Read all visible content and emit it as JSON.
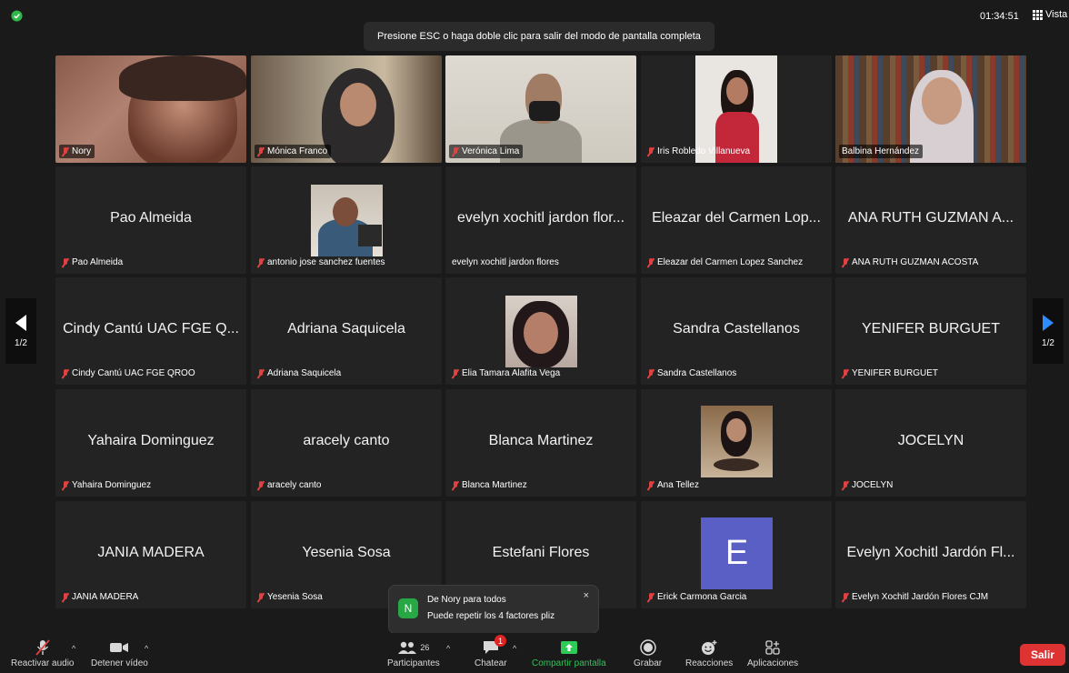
{
  "topbar": {
    "banner_text": "Presione ESC o haga doble clic para salir del modo de pantalla completa",
    "timer": "01:34:51",
    "view_label": "Vista"
  },
  "colors": {
    "active_speaker": "#4cd964",
    "accent": "#2d8cff",
    "leave": "#dd3333",
    "muted": "#e04141"
  },
  "tiles": [
    {
      "name": "Nory"
    },
    {
      "name": "Mónica Franco"
    },
    {
      "name": "Verónica Lima"
    },
    {
      "name": "Iris Robledo Villanueva"
    },
    {
      "name": "Balbina Hernández"
    },
    {
      "display": "Pao Almeida",
      "name": "Pao Almeida"
    },
    {
      "name": "antonio jose sanchez fuentes"
    },
    {
      "display": "evelyn xochitl jardon flor...",
      "name": "evelyn xochitl jardon flores"
    },
    {
      "display": "Eleazar del Carmen Lop...",
      "name": "Eleazar del Carmen Lopez Sanchez"
    },
    {
      "display": "ANA RUTH GUZMAN A...",
      "name": "ANA RUTH GUZMAN ACOSTA"
    },
    {
      "display": "Cindy Cantú UAC FGE Q...",
      "name": "Cindy Cantú UAC FGE QROO"
    },
    {
      "display": "Adriana Saquicela",
      "name": "Adriana Saquicela"
    },
    {
      "name": "Elia Tamara Alafita Vega"
    },
    {
      "display": "Sandra Castellanos",
      "name": "Sandra Castellanos"
    },
    {
      "display": "YENIFER BURGUET",
      "name": "YENIFER BURGUET"
    },
    {
      "display": "Yahaira Dominguez",
      "name": "Yahaira Dominguez"
    },
    {
      "display": "aracely canto",
      "name": "aracely canto"
    },
    {
      "display": "Blanca Martinez",
      "name": "Blanca Martinez"
    },
    {
      "name": "Ana Tellez"
    },
    {
      "display": "JOCELYN",
      "name": "JOCELYN"
    },
    {
      "display": "JANIA MADERA",
      "name": "JANIA MADERA"
    },
    {
      "display": "Yesenia Sosa",
      "name": "Yesenia Sosa"
    },
    {
      "display": "Estefani Flores",
      "name": "Estefani Flores"
    },
    {
      "avatar_letter": "E",
      "name": "Erick Carmona Garcia"
    },
    {
      "display": "Evelyn Xochitl Jardón Fl...",
      "name": "Evelyn Xochitl Jardón Flores CJM"
    }
  ],
  "pager": {
    "prev": "1/2",
    "next": "1/2"
  },
  "chat_toast": {
    "avatar": "N",
    "from": "De Nory para todos",
    "message": "Puede repetir los 4 factores pliz",
    "close": "×"
  },
  "toolbar": {
    "unmute": "Reactivar audio",
    "stop_video": "Detener vídeo",
    "participants": "Participantes",
    "participants_count": "26",
    "chat": "Chatear",
    "chat_badge": "1",
    "share": "Compartir pantalla",
    "record": "Grabar",
    "reactions": "Reacciones",
    "apps": "Aplicaciones",
    "leave": "Salir"
  }
}
